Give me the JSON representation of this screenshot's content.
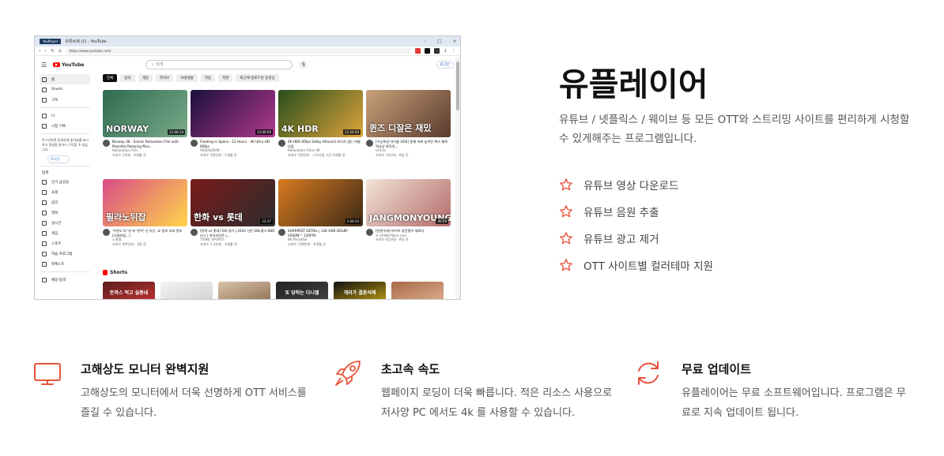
{
  "browser": {
    "tab_logo": "YouPlayer",
    "tab_title": "유튜브재 (1) - YouTube",
    "ctrl_min": "–",
    "ctrl_max": "□",
    "ctrl_close": "×",
    "url": "https://www.youtube.com/"
  },
  "youtube": {
    "logo": "YouTube",
    "search_placeholder": "검색",
    "login": "로그인",
    "sidebar": {
      "items_top": [
        "홈",
        "Shorts",
        "구독"
      ],
      "items_mid": [
        "나",
        "시청 기록"
      ],
      "note": "로그인하면 동영상에 좋아요를 표시하고 댓글을 달거나 구독할 수 있습니다.",
      "login": "로그인",
      "explore_head": "탐색",
      "items_explore": [
        "인기 급상승",
        "쇼핑",
        "음악",
        "영화",
        "실시간",
        "게임",
        "스포츠",
        "학습 프로그램",
        "팟캐스트"
      ],
      "bottom": "채널 탐색"
    },
    "chips": [
      "전체",
      "음악",
      "게임",
      "라이브",
      "야생생물",
      "자동",
      "자연",
      "최근에 업로드된 동영상"
    ],
    "videos": [
      {
        "title": "Norway 4K - Scenic Relaxation Film with Peaceful Relaxing Mus...",
        "channel": "Relaxation Film",
        "stats": "조회수 1억회 · 6개월 전",
        "overlay": "NORWAY",
        "duration": "11:00:14",
        "colors": [
          "#2f6b4f",
          "#7aa98a"
        ]
      },
      {
        "title": "Floating In Space - 12 Hours - 4K Ultra HD 60fps",
        "channel": "VISUALDON",
        "stats": "조회수 1천만회 · 1개월 전",
        "overlay": "",
        "duration": "12:00:00",
        "colors": [
          "#1a0f3f",
          "#b23a8f"
        ]
      },
      {
        "title": "4K HDR 60fps Dolby Atmos의 보이지 않는 아름다움",
        "channel": "Relaxation Films 4K",
        "stats": "조회수 1천만회 · 스트리밍 시간 4개월 전",
        "overlay": "4K HDR",
        "duration": "11:54:59",
        "colors": [
          "#264d1c",
          "#e0a53a"
        ]
      },
      {
        "title": "[수능특강 아이돌 16화] 문제 속에 숨겨진 퀴즈 제목 역사상 최악의...",
        "channel": "뇌섹 tv",
        "stats": "조회수 12만회 · 8일 전",
        "overlay": "퀸즈 디잘은 재밌",
        "duration": "",
        "colors": [
          "#c9a27a",
          "#5b3a2e"
        ]
      },
      {
        "title": "'우한도'의 '유'씨 '한이' 신 부산, 호 동보 오대 정보 [나태처럼...]",
        "channel": "노홍철",
        "stats": "조회수 4천만회 · 3일 전",
        "overlay": "필라노뒤잡",
        "duration": "",
        "colors": [
          "#d94c86",
          "#ffd54a"
        ]
      },
      {
        "title": "[한화 vs 롯데] 5/8 경기 | 2024 신한 SOL뱅크 KBO 리그 | 하이라이트 |...",
        "channel": "TVING SPORTS",
        "stats": "조회수 1.2만회 · 4개월 전",
        "overlay": "한화 vs 롯데",
        "duration": "12:37",
        "colors": [
          "#7a1a1a",
          "#2d2d2d"
        ]
      },
      {
        "title": "SHARPEST DETAIL | 12K HDR DOLBY VISION™ 120FPS",
        "channel": "8K Paradise",
        "stats": "조회수 158만회 · 6개월 전",
        "overlay": "",
        "duration": "1:04:24",
        "colors": [
          "#d77b21",
          "#3b2a16"
        ]
      },
      {
        "title": "[한중우대] 아이브 방탄쨩이 재료다",
        "channel": "또 빈대해 Place Live",
        "stats": "조회수 41만회 · 8일 전",
        "overlay": "JANGMONYOUNG",
        "duration": "40:29",
        "colors": [
          "#f2e4d6",
          "#b36b6b"
        ]
      }
    ],
    "shorts_label": "Shorts",
    "shorts": [
      {
        "text": "돈까스 먹고 실증내",
        "colors": [
          "#5a1d1d",
          "#c93434"
        ]
      },
      {
        "text": "",
        "colors": [
          "#f3f3f3",
          "#cfcfcf"
        ]
      },
      {
        "text": "",
        "colors": [
          "#d9c3a8",
          "#8a6b4f"
        ]
      },
      {
        "text": "또 당하는 다니엘",
        "colors": [
          "#222222",
          "#444444"
        ]
      },
      {
        "text": "개리가 결혼식에",
        "colors": [
          "#111111",
          "#c7a30f"
        ]
      },
      {
        "text": "",
        "colors": [
          "#a66a4a",
          "#e2b293"
        ]
      }
    ]
  },
  "product": {
    "title": "유플레이어",
    "description": "유튜브 / 넷플릭스 / 웨이브 등 모든 OTT와 스트리밍 사이트를 편리하게 시청할 수 있게해주는 프로그램입니다.",
    "features": [
      {
        "icon": "star-icon",
        "label": "유튜브 영상 다운로드"
      },
      {
        "icon": "star-icon",
        "label": "유튜브 음원 추출"
      },
      {
        "icon": "star-icon",
        "label": "유튜브 광고 제거"
      },
      {
        "icon": "star-icon",
        "label": "OTT 사이트별 컬러테마 지원"
      }
    ],
    "accent_color": "#e8533a"
  },
  "highlights": [
    {
      "icon": "monitor-icon",
      "title": "고해상도 모니터 완벽지원",
      "text": "고해상도의 모니터에서 더욱 선명하게 OTT 서비스를 즐길 수 있습니다."
    },
    {
      "icon": "rocket-icon",
      "title": "초고속 속도",
      "text": "웹페이지 로딩이 더욱 빠릅니다. 적은 리소스 사용으로 저사양 PC 에서도 4k 를 사용할 수 있습니다."
    },
    {
      "icon": "refresh-icon",
      "title": "무료 업데이트",
      "text": "유플레이어는 무료 소프트웨어입니다. 프로그램은 무료로 지속 업데이트 됩니다."
    }
  ]
}
